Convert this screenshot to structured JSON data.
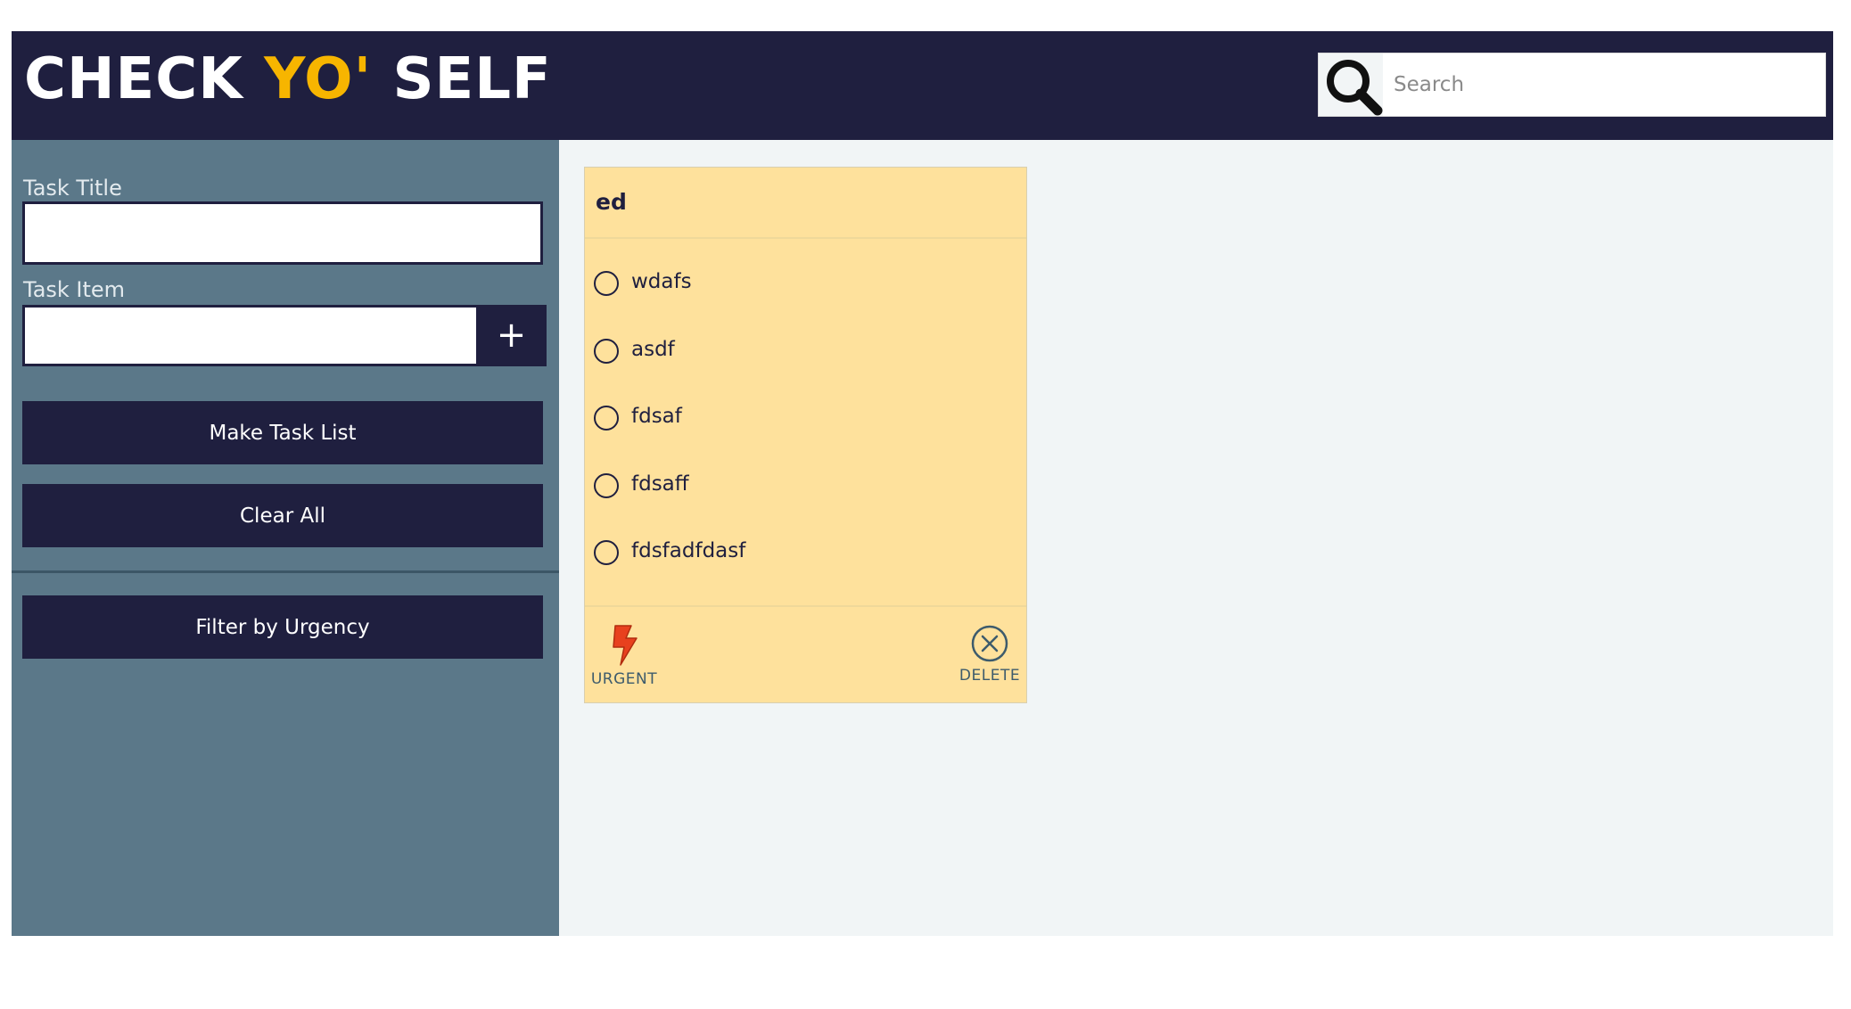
{
  "header": {
    "logo_part1": "CHECK ",
    "logo_accent": "YO'",
    "logo_part2": " SELF",
    "search": {
      "placeholder": "Search",
      "value": ""
    }
  },
  "sidebar": {
    "task_title_label": "Task Title",
    "task_title_value": "",
    "task_item_label": "Task Item",
    "task_item_value": "",
    "add_item_label": "+",
    "make_task_list_label": "Make Task List",
    "clear_all_label": "Clear All",
    "filter_urgency_label": "Filter by Urgency"
  },
  "main": {
    "card": {
      "title": "ed",
      "items": [
        {
          "text": "wdafs",
          "checked": false
        },
        {
          "text": "asdf",
          "checked": false
        },
        {
          "text": "fdsaf",
          "checked": false
        },
        {
          "text": "fdsaff",
          "checked": false
        },
        {
          "text": "fdsfadfdasf",
          "checked": false
        }
      ],
      "urgent_label": "URGENT",
      "delete_label": "DELETE"
    }
  },
  "colors": {
    "header_bg": "#1f1f3f",
    "logo_accent": "#f7b500",
    "sidebar_bg": "#5b7889",
    "main_bg": "#f1f5f6",
    "card_bg": "#fee19c",
    "urgent_icon": "#e8411e"
  },
  "icons": {
    "search": "search-icon",
    "add": "plus-icon",
    "urgent": "lightning-bolt-icon",
    "delete": "circle-x-icon",
    "checkbox": "radio-circle-icon"
  }
}
